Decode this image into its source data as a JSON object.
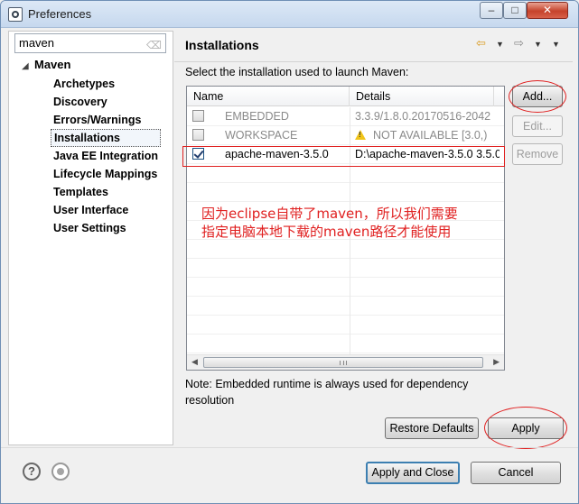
{
  "window": {
    "title": "Preferences",
    "minimize_glyph": "‒",
    "maximize_glyph": "□",
    "close_glyph": "✕"
  },
  "sidebar": {
    "filter_value": "maven",
    "root_label": "Maven",
    "items": [
      {
        "label": "Archetypes"
      },
      {
        "label": "Discovery"
      },
      {
        "label": "Errors/Warnings"
      },
      {
        "label": "Installations",
        "selected": true
      },
      {
        "label": "Java EE Integration"
      },
      {
        "label": "Lifecycle Mappings"
      },
      {
        "label": "Templates"
      },
      {
        "label": "User Interface"
      },
      {
        "label": "User Settings"
      }
    ]
  },
  "page": {
    "title": "Installations",
    "description": "Select the installation used to launch Maven:",
    "columns": {
      "name": "Name",
      "details": "Details"
    },
    "rows": [
      {
        "checked": false,
        "name": "EMBEDDED",
        "details": "3.3.9/1.8.0.20170516-2042",
        "disabled": true
      },
      {
        "checked": false,
        "name": "WORKSPACE",
        "details": "NOT AVAILABLE [3.0,)",
        "disabled": true,
        "warning": true
      },
      {
        "checked": true,
        "name": "apache-maven-3.5.0",
        "details": "D:\\apache-maven-3.5.0 3.5.0",
        "disabled": false
      }
    ],
    "annotation_line1": "因为eclipse自带了maven，所以我们需要",
    "annotation_line2": "指定电脑本地下载的maven路径才能使用",
    "buttons": {
      "add": "Add...",
      "edit": "Edit...",
      "remove": "Remove",
      "restore_defaults": "Restore Defaults",
      "apply": "Apply"
    },
    "note_line1": "Note: Embedded runtime is always used for dependency",
    "note_line2": "resolution"
  },
  "footer": {
    "apply_and_close": "Apply and Close",
    "cancel": "Cancel"
  },
  "colors": {
    "annotation_red": "#e02020",
    "default_button_border": "#3c7fb1",
    "titlebar": "#c6d8ee"
  },
  "icons": {
    "nav_back": "arrow-left-icon",
    "nav_forward": "arrow-right-icon",
    "help": "help-icon",
    "import_export": "import-icon",
    "warning": "warning-icon"
  }
}
